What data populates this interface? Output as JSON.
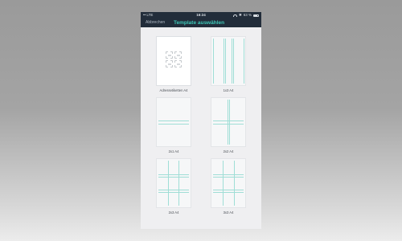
{
  "status_bar": {
    "carrier": "•• LTE",
    "time": "16:24",
    "right_text": "63 %",
    "icons": [
      "wifi-icon",
      "bluetooth-icon",
      "battery-icon"
    ]
  },
  "nav": {
    "back_label": "Abbrechen",
    "title": "Template auswählen"
  },
  "templates": [
    {
      "label": "Adressetiketten A4"
    },
    {
      "label": "1x3 A4"
    },
    {
      "label": "2x1 A4"
    },
    {
      "label": "2x2 A4"
    },
    {
      "label": "2x3 A4"
    },
    {
      "label": "3x3 A4"
    }
  ],
  "colors": {
    "nav_bg": "#222d3a",
    "accent": "#3ec7b7",
    "grid_line": "#9fded6",
    "screen_bg": "#efeff1"
  }
}
